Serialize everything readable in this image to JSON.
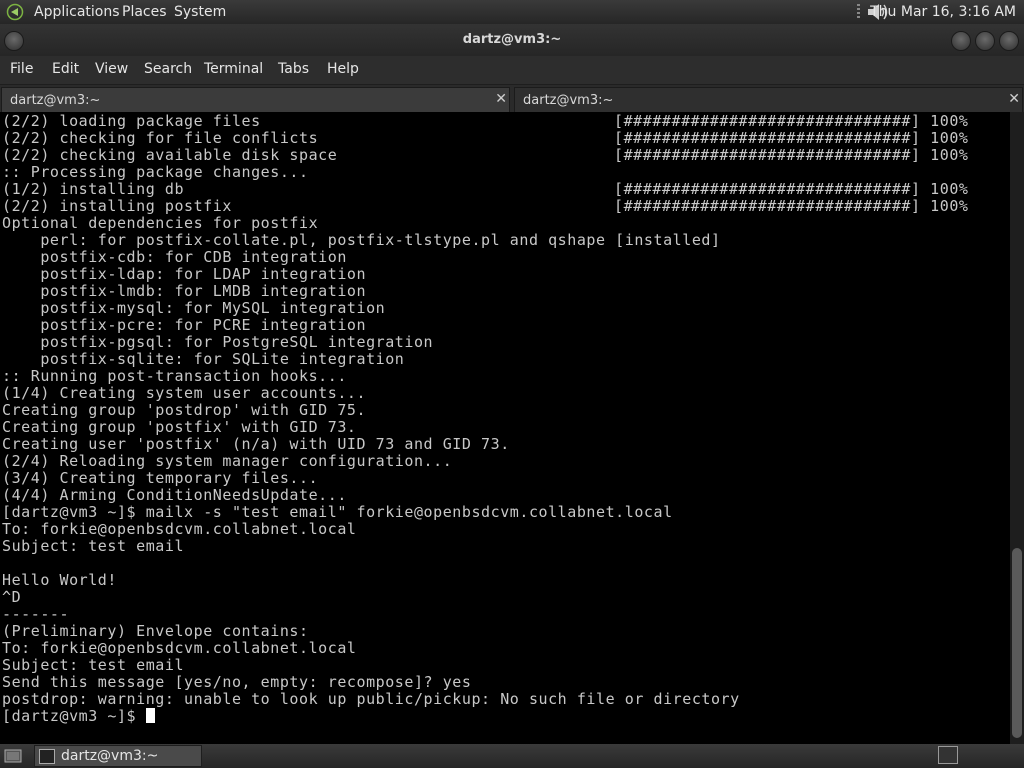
{
  "top_panel": {
    "menus": [
      "Applications",
      "Places",
      "System"
    ],
    "clock": "Thu Mar 16,  3:16 AM"
  },
  "window": {
    "title": "dartz@vm3:~",
    "menu": [
      "File",
      "Edit",
      "View",
      "Search",
      "Terminal",
      "Tabs",
      "Help"
    ],
    "tabs": [
      {
        "label": "dartz@vm3:~",
        "active": true
      },
      {
        "label": "dartz@vm3:~",
        "active": false
      }
    ]
  },
  "terminal": {
    "lines": [
      {
        "text": "(2/2) loading package files",
        "progress": "[##############################] 100%"
      },
      {
        "text": "(2/2) checking for file conflicts",
        "progress": "[##############################] 100%"
      },
      {
        "text": "(2/2) checking available disk space",
        "progress": "[##############################] 100%"
      },
      {
        "text": ":: Processing package changes...",
        "progress": ""
      },
      {
        "text": "(1/2) installing db",
        "progress": "[##############################] 100%"
      },
      {
        "text": "(2/2) installing postfix",
        "progress": "[##############################] 100%"
      },
      {
        "text": "Optional dependencies for postfix",
        "progress": ""
      },
      {
        "text": "    perl: for postfix-collate.pl, postfix-tlstype.pl and qshape [installed]",
        "progress": ""
      },
      {
        "text": "    postfix-cdb: for CDB integration",
        "progress": ""
      },
      {
        "text": "    postfix-ldap: for LDAP integration",
        "progress": ""
      },
      {
        "text": "    postfix-lmdb: for LMDB integration",
        "progress": ""
      },
      {
        "text": "    postfix-mysql: for MySQL integration",
        "progress": ""
      },
      {
        "text": "    postfix-pcre: for PCRE integration",
        "progress": ""
      },
      {
        "text": "    postfix-pgsql: for PostgreSQL integration",
        "progress": ""
      },
      {
        "text": "    postfix-sqlite: for SQLite integration",
        "progress": ""
      },
      {
        "text": ":: Running post-transaction hooks...",
        "progress": ""
      },
      {
        "text": "(1/4) Creating system user accounts...",
        "progress": ""
      },
      {
        "text": "Creating group 'postdrop' with GID 75.",
        "progress": ""
      },
      {
        "text": "Creating group 'postfix' with GID 73.",
        "progress": ""
      },
      {
        "text": "Creating user 'postfix' (n/a) with UID 73 and GID 73.",
        "progress": ""
      },
      {
        "text": "(2/4) Reloading system manager configuration...",
        "progress": ""
      },
      {
        "text": "(3/4) Creating temporary files...",
        "progress": ""
      },
      {
        "text": "(4/4) Arming ConditionNeedsUpdate...",
        "progress": ""
      },
      {
        "text": "[dartz@vm3 ~]$ mailx -s \"test email\" forkie@openbsdcvm.collabnet.local",
        "progress": ""
      },
      {
        "text": "To: forkie@openbsdcvm.collabnet.local",
        "progress": ""
      },
      {
        "text": "Subject: test email",
        "progress": ""
      },
      {
        "text": "",
        "progress": ""
      },
      {
        "text": "Hello World!",
        "progress": ""
      },
      {
        "text": "^D",
        "progress": ""
      },
      {
        "text": "-------",
        "progress": ""
      },
      {
        "text": "(Preliminary) Envelope contains:",
        "progress": ""
      },
      {
        "text": "To: forkie@openbsdcvm.collabnet.local",
        "progress": ""
      },
      {
        "text": "Subject: test email",
        "progress": ""
      },
      {
        "text": "Send this message [yes/no, empty: recompose]? yes",
        "progress": ""
      },
      {
        "text": "postdrop: warning: unable to look up public/pickup: No such file or directory",
        "progress": ""
      }
    ],
    "prompt": "[dartz@vm3 ~]$ "
  },
  "bottom_panel": {
    "task_label": "dartz@vm3:~"
  },
  "colors": {
    "terminal_bg": "#000000",
    "terminal_fg": "#c8c8c8",
    "panel_bg": "#2e2e2e"
  }
}
